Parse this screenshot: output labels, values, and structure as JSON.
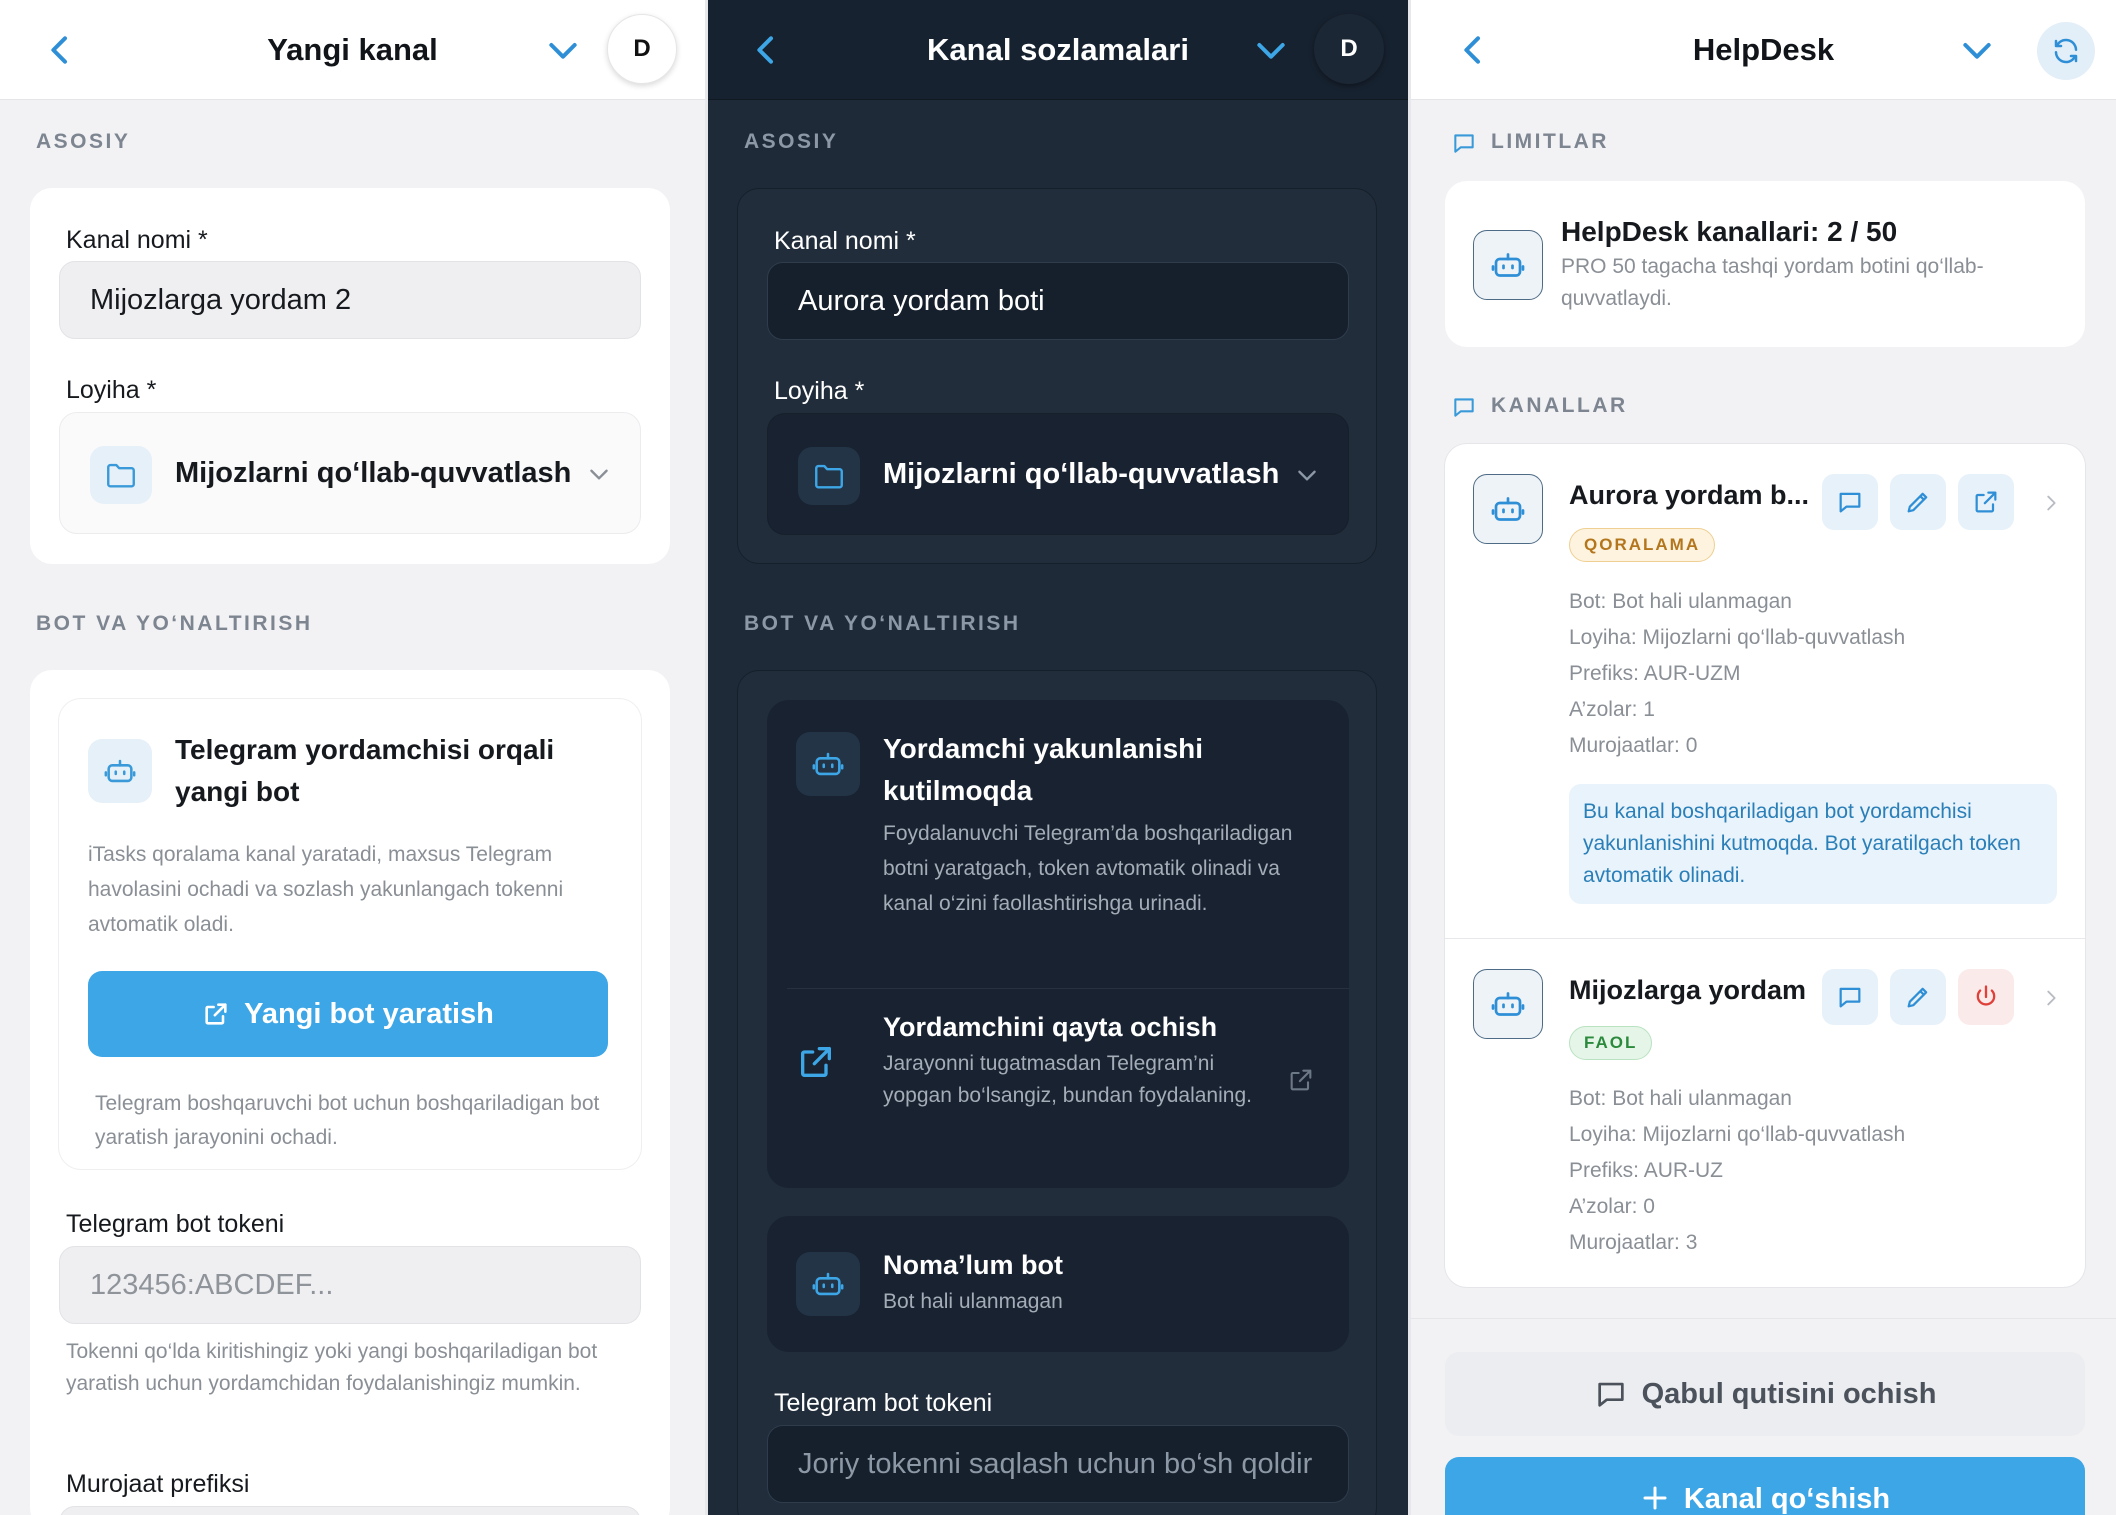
{
  "colors": {
    "accent": "#3da6e6",
    "dark_bg": "#1f2a38",
    "light_bg": "#f2f2f4",
    "draft": "#b4761d",
    "active": "#2c8a3d",
    "danger": "#e0403a"
  },
  "panel1": {
    "title": "Yangi kanal",
    "avatar": "D",
    "sections": {
      "main": "ASOSIY",
      "bot": "BOT VA YO‘NALTIRISH"
    },
    "channel_name_label": "Kanal nomi *",
    "channel_name_value": "Mijozlarga yordam 2",
    "project_label": "Loyiha *",
    "project_value": "Mijozlarni qo‘llab-quvvatlash",
    "wizard": {
      "title": "Telegram yordamchisi orqali yangi bot",
      "desc": "iTasks qoralama kanal yaratadi, maxsus Telegram havolasini ochadi va sozlash yakunlangach tokenni avtomatik oladi.",
      "button": "Yangi bot yaratish",
      "hint": "Telegram boshqaruvchi bot uchun boshqariladigan bot yaratish jarayonini ochadi."
    },
    "token_label": "Telegram bot tokeni",
    "token_placeholder": "123456:ABCDEF...",
    "token_hint": "Tokenni qo‘lda kiritishingiz yoki yangi boshqariladigan bot yaratish uchun yordamchidan foydalanishingiz mumkin.",
    "prefix_label": "Murojaat prefiksi"
  },
  "panel2": {
    "title": "Kanal sozlamalari",
    "avatar": "D",
    "sections": {
      "main": "ASOSIY",
      "bot": "BOT VA YO‘NALTIRISH"
    },
    "channel_name_label": "Kanal nomi *",
    "channel_name_value": "Aurora yordam boti",
    "project_label": "Loyiha *",
    "project_value": "Mijozlarni qo‘llab-quvvatlash",
    "pending": {
      "title": "Yordamchi yakunlanishi kutilmoqda",
      "desc": "Foydalanuvchi Telegram’da boshqariladigan botni yaratgach, token avtomatik olinadi va kanal o‘zini faollashtirishga urinadi."
    },
    "reopen": {
      "title": "Yordamchini qayta ochish",
      "desc": "Jarayonni tugatmasdan Telegram’ni yopgan bo‘lsangiz, bundan foydalaning."
    },
    "unknown_bot": {
      "title": "Noma’lum bot",
      "desc": "Bot hali ulanmagan"
    },
    "token_label": "Telegram bot tokeni",
    "token_placeholder": "Joriy tokenni saqlash uchun bo‘sh qoldir"
  },
  "panel3": {
    "title": "HelpDesk",
    "sections": {
      "limits": "LIMITLAR",
      "channels": "KANALLAR"
    },
    "limits": {
      "title": "HelpDesk kanallari: 2 / 50",
      "desc": "PRO 50 tagacha tashqi yordam botini qo‘llab-quvvatlaydi."
    },
    "channels": [
      {
        "name": "Aurora yordam b...",
        "badge": "QORALAMA",
        "bot": "Bot: Bot hali ulanmagan",
        "project": "Loyiha: Mijozlarni qo‘llab-quvvatlash",
        "prefix": "Prefiks: AUR-UZM",
        "members": "A’zolar: 1",
        "tickets": "Murojaatlar: 0",
        "notice": "Bu kanal boshqariladigan bot yordamchisi yakunlanishini kutmoqda. Bot yaratilgach token avtomatik olinadi."
      },
      {
        "name": "Mijozlarga yordam",
        "badge": "FAOL",
        "bot": "Bot: Bot hali ulanmagan",
        "project": "Loyiha: Mijozlarni qo‘llab-quvvatlash",
        "prefix": "Prefiks: AUR-UZ",
        "members": "A’zolar: 0",
        "tickets": "Murojaatlar: 3"
      }
    ],
    "inbox_button": "Qabul qutisini ochish",
    "add_button": "Kanal qo‘shish"
  }
}
